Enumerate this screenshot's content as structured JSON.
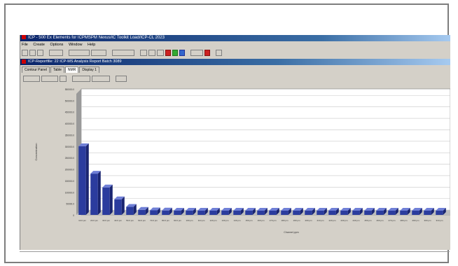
{
  "window": {
    "title": "ICP - 500 Ex Elements for ICPMSPM Nexus/IC Toolkit Load/ICP-CL 2023",
    "menu": [
      "File",
      "Create",
      "Options",
      "Window",
      "Help"
    ]
  },
  "child_window": {
    "title": "ICP-Reportfile: 22 ICP-MS Analysis Report Batch 3089"
  },
  "tabs": [
    {
      "label": "Contour Panel"
    },
    {
      "label": "Table"
    },
    {
      "label": "NMR"
    },
    {
      "label": "Display 1"
    }
  ],
  "colors": {
    "bar_front": "#2b3c9e",
    "bar_top": "#6f7fd6",
    "bar_side": "#1a2570",
    "plot_bg": "#ffffff",
    "wall": "#9a9a9a"
  },
  "chart_data": {
    "type": "bar",
    "title": "",
    "ylabel": "Concentration",
    "xlabel": "Channel ppm",
    "yticks": [
      "0",
      "50000.0",
      "100000.0",
      "150000.0",
      "200000.0",
      "250000.0",
      "300000.0",
      "350000.0",
      "400000.0",
      "450000.0",
      "500000.0",
      "550000.0"
    ],
    "ylim": [
      0,
      550000
    ],
    "grid": true,
    "categories": [
      "10.0 pm",
      "20.0 pm",
      "30.0 pm",
      "40.0 pm",
      "50.0 pm",
      "60.0 pm",
      "70.0 pm",
      "80.0 pm",
      "90.0 pm",
      "100 pm",
      "110 pm",
      "120 pm",
      "130 pm",
      "140 pm",
      "150 pm",
      "160 pm",
      "170 pm",
      "180 pm",
      "190 pm",
      "200 pm",
      "210 pm",
      "220 pm",
      "230 pm",
      "240 pm",
      "250 pm",
      "260 pm",
      "270 pm",
      "280 pm",
      "290 pm",
      "300 pm",
      "310 pm"
    ],
    "values": [
      300000,
      180000,
      120000,
      68000,
      35000,
      22000,
      20000,
      19000,
      18500,
      18500,
      18500,
      18500,
      18500,
      18500,
      18500,
      18500,
      18500,
      18500,
      18500,
      18500,
      18500,
      18500,
      18500,
      18500,
      18500,
      18500,
      18500,
      18500,
      18500,
      18500,
      18500
    ]
  }
}
